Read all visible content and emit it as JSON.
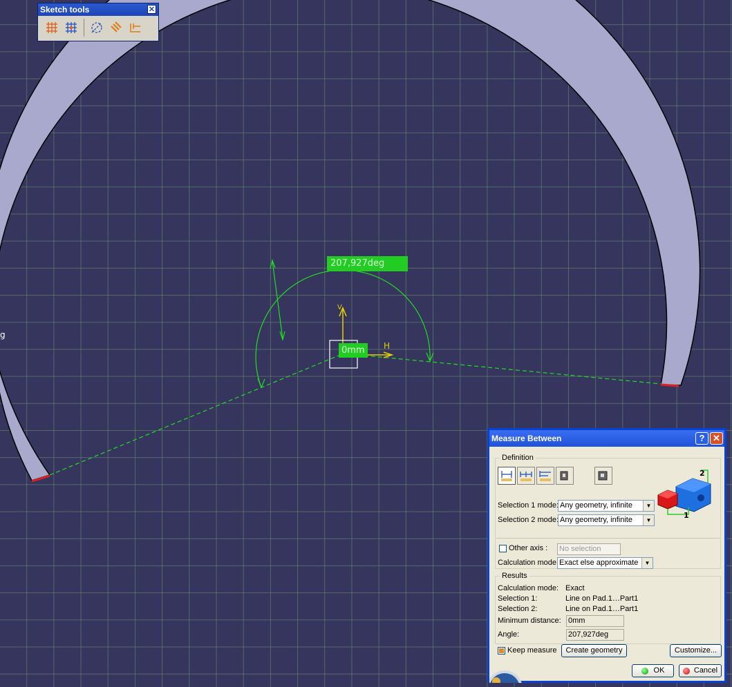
{
  "sketch_toolbar": {
    "title": "Sketch tools",
    "icons": [
      "grid-icon",
      "snap-to-point-icon",
      "construction-element-icon",
      "geometric-constraints-icon",
      "dimensional-constraints-icon"
    ]
  },
  "viewport": {
    "angle_dimension": "207,927deg",
    "distance_dimension": "0mm",
    "h_axis_label": "H",
    "v_axis_label": "V",
    "left_edge_fragment": "g"
  },
  "measure_dialog": {
    "title": "Measure Between",
    "help_label": "?",
    "close_label": "✕",
    "definition": {
      "group_title": "Definition",
      "selection1_label": "Selection 1 mode:",
      "selection1_value": "Any geometry, infinite",
      "selection2_label": "Selection 2 mode:",
      "selection2_value": "Any geometry, infinite",
      "other_axis_label": "Other axis :",
      "other_axis_placeholder": "No selection",
      "calc_mode_label": "Calculation mode:",
      "calc_mode_value": "Exact else approximate",
      "illustration_labels": [
        "1",
        "2"
      ]
    },
    "results": {
      "group_title": "Results",
      "rows": [
        {
          "label": "Calculation mode:",
          "value": "Exact"
        },
        {
          "label": "Selection 1:",
          "value": "Line on Pad.1…Part1"
        },
        {
          "label": "Selection 2:",
          "value": "Line on Pad.1…Part1"
        }
      ],
      "min_distance_label": "Minimum distance:",
      "min_distance_value": "0mm",
      "angle_label": "Angle:",
      "angle_value": "207,927deg"
    },
    "keep_measure_label": "Keep measure",
    "create_geometry_label": "Create geometry",
    "customize_label": "Customize...",
    "ok_label": "OK",
    "cancel_label": "Cancel"
  }
}
